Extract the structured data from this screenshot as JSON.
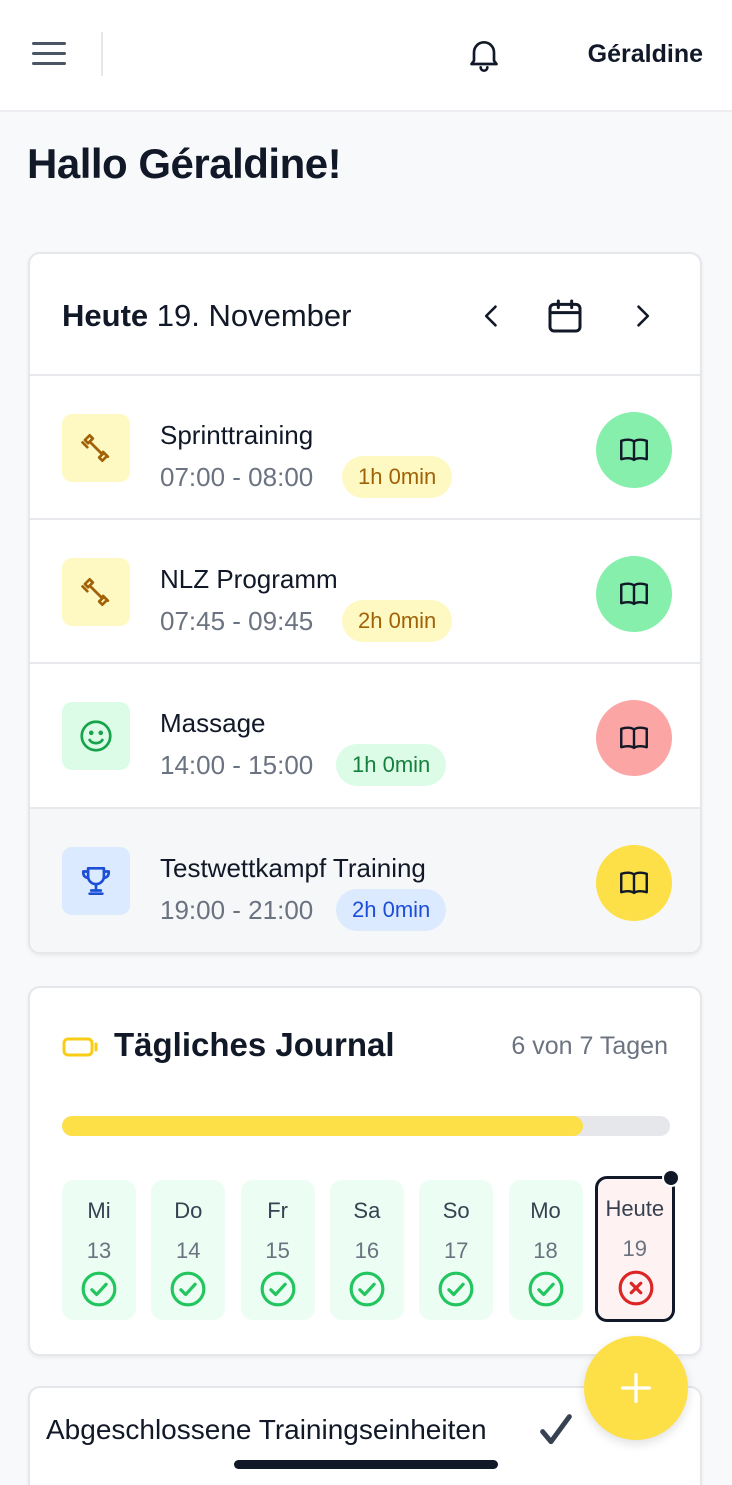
{
  "header": {
    "user_name": "Géraldine"
  },
  "greeting": "Hallo Géraldine!",
  "today": {
    "label": "Heute",
    "date": "19. November",
    "events": [
      {
        "title": "Sprinttraining",
        "time": "07:00 - 08:00",
        "duration": "1h 0min",
        "icon": "dumbbell-icon",
        "book_status": "green"
      },
      {
        "title": "NLZ Programm",
        "time": "07:45 - 09:45",
        "duration": "2h 0min",
        "icon": "dumbbell-icon",
        "book_status": "green"
      },
      {
        "title": "Massage",
        "time": "14:00 - 15:00",
        "duration": "1h 0min",
        "icon": "smiley-icon",
        "book_status": "red"
      },
      {
        "title": "Testwettkampf Training",
        "time": "19:00 - 21:00",
        "duration": "2h 0min",
        "icon": "trophy-icon",
        "book_status": "yellow"
      }
    ]
  },
  "journal": {
    "title": "Tägliches Journal",
    "count": "6 von 7 Tagen",
    "progress": 0.857,
    "days": [
      {
        "name": "Mi",
        "num": "13",
        "done": true
      },
      {
        "name": "Do",
        "num": "14",
        "done": true
      },
      {
        "name": "Fr",
        "num": "15",
        "done": true
      },
      {
        "name": "Sa",
        "num": "16",
        "done": true
      },
      {
        "name": "So",
        "num": "17",
        "done": true
      },
      {
        "name": "Mo",
        "num": "18",
        "done": true
      },
      {
        "name": "Heute",
        "num": "19",
        "done": false
      }
    ]
  },
  "completed": {
    "title": "Abgeschlossene Trainingseinheiten"
  },
  "colors": {
    "accent_yellow": "#fde047",
    "success_green": "#22c55e",
    "error_red": "#dc2626",
    "book_green": "#86efac",
    "book_red": "#fca5a5",
    "book_yellow": "#fde047"
  }
}
